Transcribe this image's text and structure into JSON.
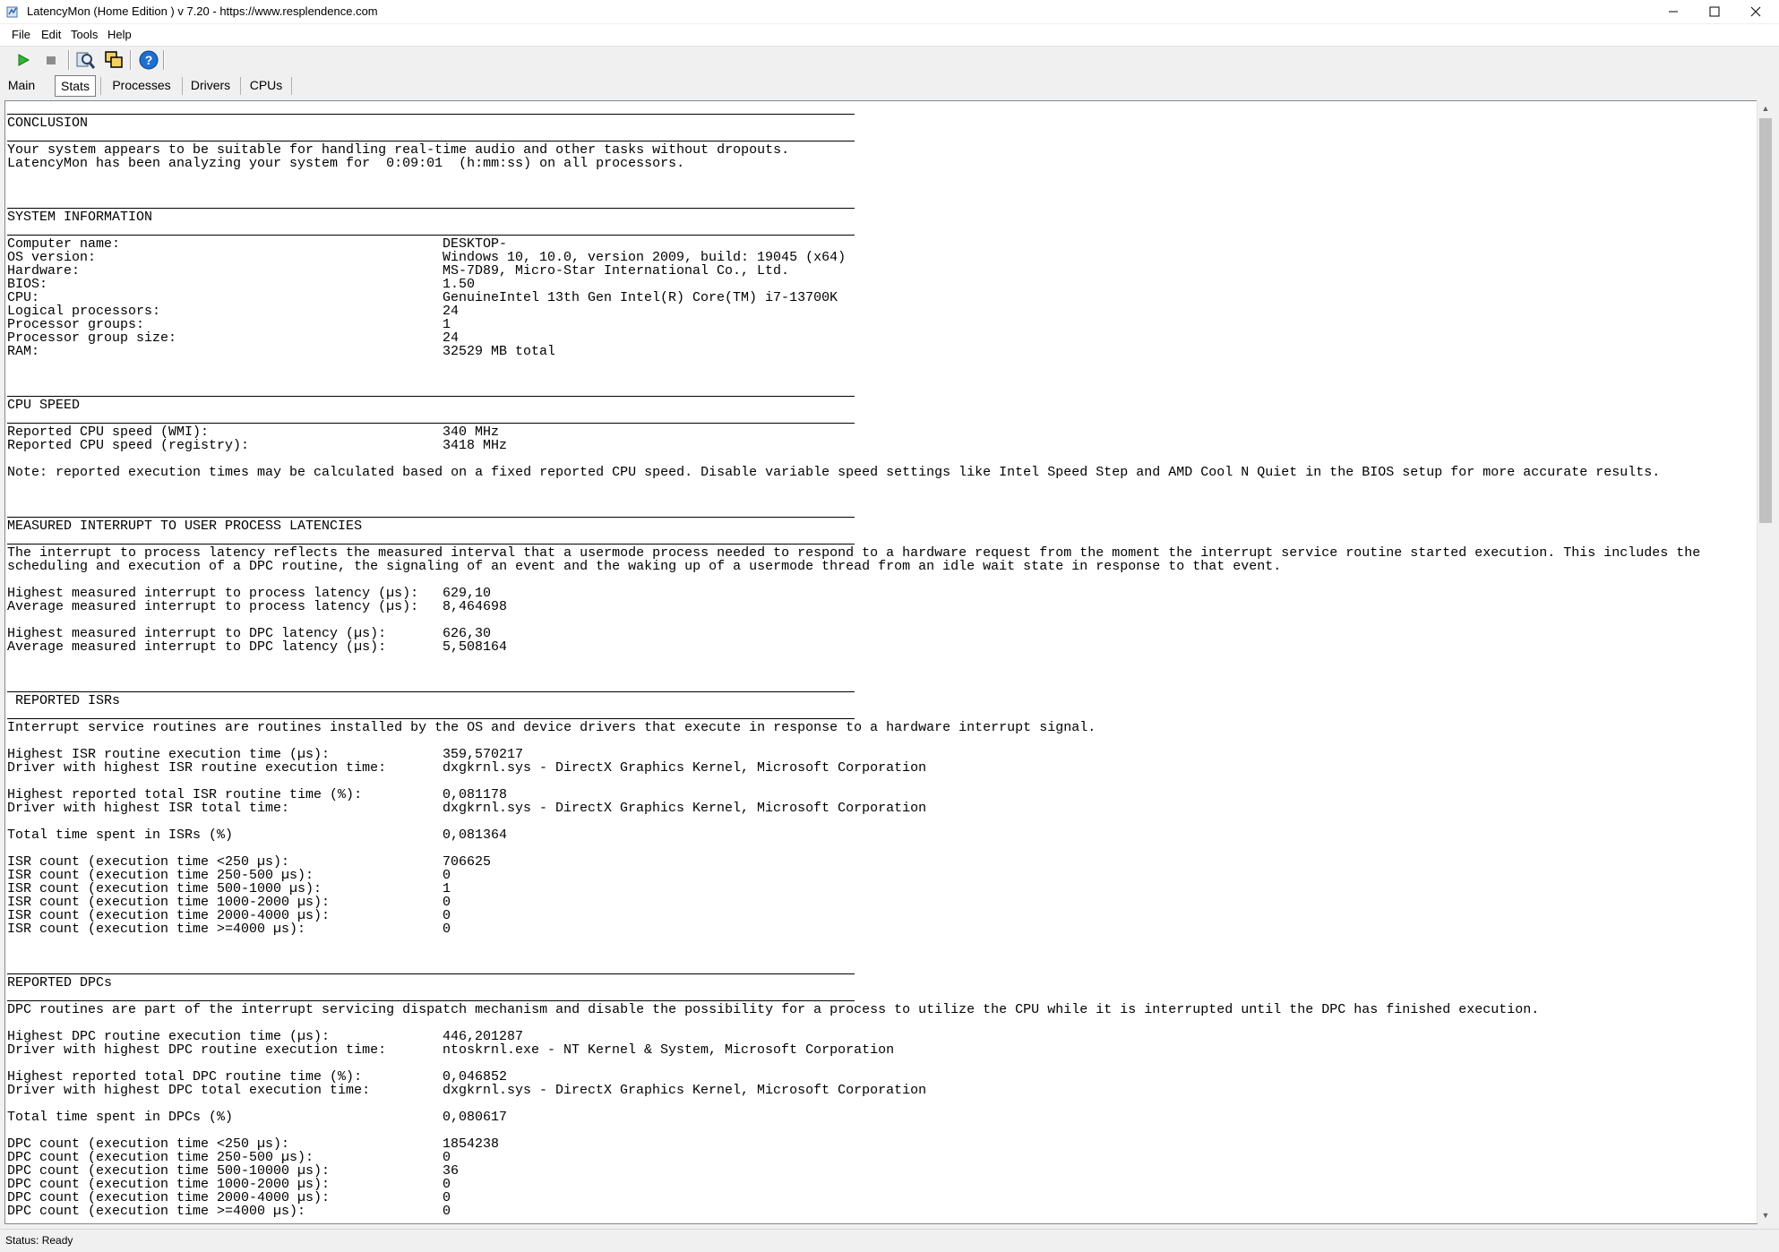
{
  "window": {
    "title": "LatencyMon  (Home Edition )  v 7.20 - https://www.resplendence.com",
    "minimize_icon": "minimize-icon",
    "maximize_icon": "maximize-icon",
    "close_icon": "close-icon"
  },
  "menu": [
    "File",
    "Edit",
    "Tools",
    "Help"
  ],
  "toolbar": {
    "buttons": [
      "play-icon",
      "stop-icon",
      "search-tool-icon",
      "copy-windows-icon",
      "help-icon"
    ]
  },
  "tabs": [
    "Main",
    "Stats",
    "Processes",
    "Drivers",
    "CPUs"
  ],
  "active_tab": "Stats",
  "report": {
    "conclusion": {
      "title": "CONCLUSION",
      "lines": [
        "Your system appears to be suitable for handling real-time audio and other tasks without dropouts.",
        "LatencyMon has been analyzing your system for  0:09:01  (h:mm:ss) on all processors."
      ]
    },
    "system_info": {
      "title": "SYSTEM INFORMATION",
      "rows": [
        {
          "label": "Computer name:",
          "value": "DESKTOP-"
        },
        {
          "label": "OS version:",
          "value": "Windows 10, 10.0, version 2009, build: 19045 (x64)"
        },
        {
          "label": "Hardware:",
          "value": "MS-7D89, Micro-Star International Co., Ltd."
        },
        {
          "label": "BIOS:",
          "value": "1.50"
        },
        {
          "label": "CPU:",
          "value": "GenuineIntel 13th Gen Intel(R) Core(TM) i7-13700K"
        },
        {
          "label": "Logical processors:",
          "value": "24"
        },
        {
          "label": "Processor groups:",
          "value": "1"
        },
        {
          "label": "Processor group size:",
          "value": "24"
        },
        {
          "label": "RAM:",
          "value": "32529 MB total"
        }
      ]
    },
    "cpu_speed": {
      "title": "CPU SPEED",
      "rows": [
        {
          "label": "Reported CPU speed (WMI):",
          "value": "340 MHz"
        },
        {
          "label": "Reported CPU speed (registry):",
          "value": "3418 MHz"
        }
      ],
      "note": "Note: reported execution times may be calculated based on a fixed reported CPU speed. Disable variable speed settings like Intel Speed Step and AMD Cool N Quiet in the BIOS setup for more accurate results."
    },
    "interrupt_latency": {
      "title": "MEASURED INTERRUPT TO USER PROCESS LATENCIES",
      "desc_lines": [
        "The interrupt to process latency reflects the measured interval that a usermode process needed to respond to a hardware request from the moment the interrupt service routine started execution. This includes the",
        "scheduling and execution of a DPC routine, the signaling of an event and the waking up of a usermode thread from an idle wait state in response to that event."
      ],
      "rows": [
        {
          "label": "Highest measured interrupt to process latency (µs):",
          "value": "629,10"
        },
        {
          "label": "Average measured interrupt to process latency (µs):",
          "value": "8,464698"
        },
        {
          "label": "Highest measured interrupt to DPC latency (µs):",
          "value": "626,30"
        },
        {
          "label": "Average measured interrupt to DPC latency (µs):",
          "value": "5,508164"
        }
      ]
    },
    "isrs": {
      "title": " REPORTED ISRs",
      "desc": "Interrupt service routines are routines installed by the OS and device drivers that execute in response to a hardware interrupt signal.",
      "rows": [
        {
          "label": "Highest ISR routine execution time (µs):",
          "value": "359,570217"
        },
        {
          "label": "Driver with highest ISR routine execution time:",
          "value": "dxgkrnl.sys - DirectX Graphics Kernel, Microsoft Corporation"
        },
        {
          "label": "Highest reported total ISR routine time (%):",
          "value": "0,081178"
        },
        {
          "label": "Driver with highest ISR total time:",
          "value": "dxgkrnl.sys - DirectX Graphics Kernel, Microsoft Corporation"
        },
        {
          "label": "Total time spent in ISRs (%)",
          "value": "0,081364"
        },
        {
          "label": "ISR count (execution time <250 µs):",
          "value": "706625"
        },
        {
          "label": "ISR count (execution time 250-500 µs):",
          "value": "0"
        },
        {
          "label": "ISR count (execution time 500-1000 µs):",
          "value": "1"
        },
        {
          "label": "ISR count (execution time 1000-2000 µs):",
          "value": "0"
        },
        {
          "label": "ISR count (execution time 2000-4000 µs):",
          "value": "0"
        },
        {
          "label": "ISR count (execution time >=4000 µs):",
          "value": "0"
        }
      ]
    },
    "dpcs": {
      "title": "REPORTED DPCs",
      "desc": "DPC routines are part of the interrupt servicing dispatch mechanism and disable the possibility for a process to utilize the CPU while it is interrupted until the DPC has finished execution.",
      "rows": [
        {
          "label": "Highest DPC routine execution time (µs):",
          "value": "446,201287"
        },
        {
          "label": "Driver with highest DPC routine execution time:",
          "value": "ntoskrnl.exe - NT Kernel & System, Microsoft Corporation"
        },
        {
          "label": "Highest reported total DPC routine time (%):",
          "value": "0,046852"
        },
        {
          "label": "Driver with highest DPC total execution time:",
          "value": "dxgkrnl.sys - DirectX Graphics Kernel, Microsoft Corporation"
        },
        {
          "label": "Total time spent in DPCs (%)",
          "value": "0,080617"
        },
        {
          "label": "DPC count (execution time <250 µs):",
          "value": "1854238"
        },
        {
          "label": "DPC count (execution time 250-500 µs):",
          "value": "0"
        },
        {
          "label": "DPC count (execution time 500-10000 µs):",
          "value": "36"
        },
        {
          "label": "DPC count (execution time 1000-2000 µs):",
          "value": "0"
        },
        {
          "label": "DPC count (execution time 2000-4000 µs):",
          "value": "0"
        },
        {
          "label": "DPC count (execution time >=4000 µs):",
          "value": "0"
        }
      ]
    }
  },
  "status": "Status: Ready",
  "colors": {
    "play": "#2eb82e",
    "help": "#1e6fd0",
    "border": "#828790"
  }
}
